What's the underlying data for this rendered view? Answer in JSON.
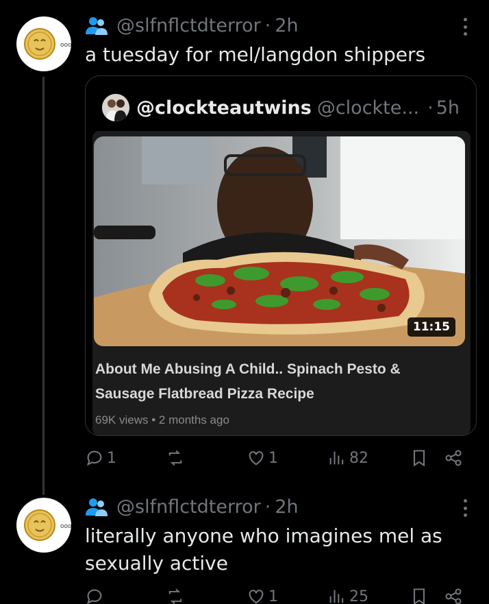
{
  "posts": [
    {
      "handle": "@slfnflctdterror",
      "separator": "·",
      "time": "2h",
      "text": "a tuesday for mel/langdon shippers",
      "quote": {
        "name": "@clockteautwins",
        "handle": "@clockte...",
        "separator": "·",
        "time": "5h",
        "video": {
          "duration": "11:15",
          "title": "About Me Abusing A Child.. Spinach Pesto & Sausage Flatbread Pizza Recipe",
          "views": "69K views",
          "meta_separator": "•",
          "age": "2 months ago"
        }
      },
      "actions": {
        "replies": "1",
        "reposts": "",
        "likes": "1",
        "views": "82"
      }
    },
    {
      "handle": "@slfnflctdterror",
      "separator": "·",
      "time": "2h",
      "text": "literally anyone who imagines mel as sexually active",
      "actions": {
        "replies": "",
        "reposts": "",
        "likes": "1",
        "views": "25"
      }
    }
  ],
  "icons": [
    "group-icon",
    "more-icon",
    "reply-icon",
    "repost-icon",
    "like-icon",
    "views-icon",
    "bookmark-icon",
    "share-icon"
  ],
  "colors": {
    "background": "#000000",
    "text": "#e7e9ea",
    "muted": "#71767b",
    "border": "#2f3336",
    "group_icon": "#1d9bf0"
  }
}
